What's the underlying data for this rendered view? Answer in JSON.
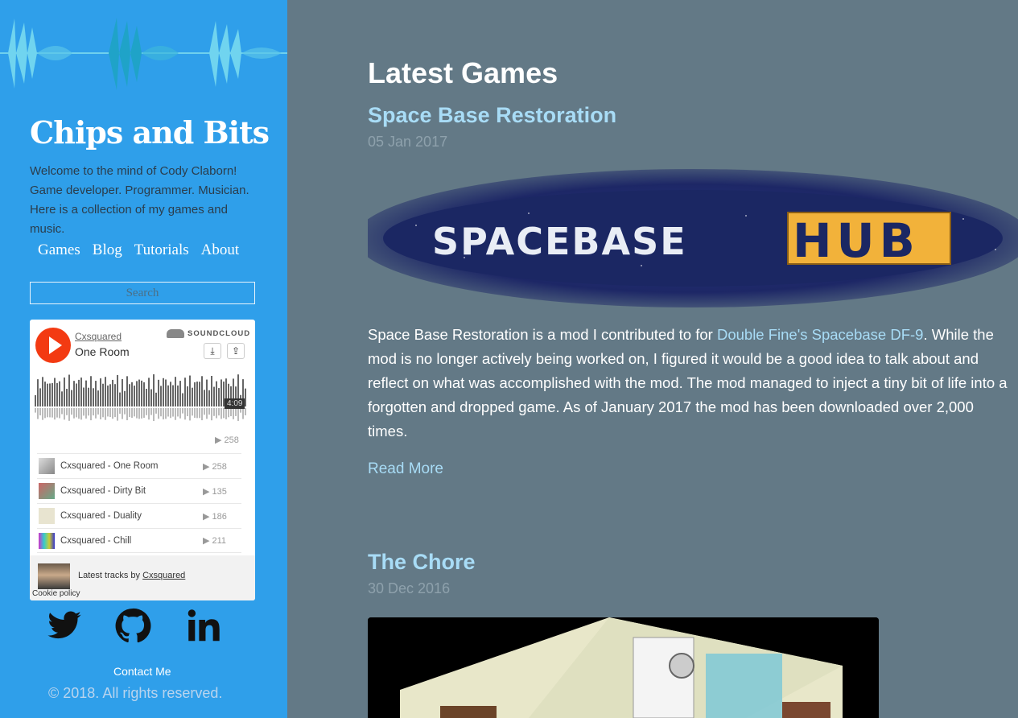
{
  "sidebar": {
    "title": "Chips and Bits",
    "description": "Welcome to the mind of Cody Claborn! Game developer. Programmer. Musician. Here is a collection of my games and music.",
    "nav": [
      "Games",
      "Blog",
      "Tutorials",
      "About"
    ],
    "search_placeholder": "Search",
    "contact": "Contact Me",
    "copyright": "© 2018. All rights reserved.",
    "social_icons": [
      "twitter-icon",
      "github-icon",
      "linkedin-icon"
    ]
  },
  "soundcloud": {
    "user": "Cxsquared",
    "track": "One Room",
    "brand": "SOUNDCLOUD",
    "duration": "4:09",
    "plays": "258",
    "tracks": [
      {
        "title": "Cxsquared - One Room",
        "plays": "258"
      },
      {
        "title": "Cxsquared - Dirty Bit",
        "plays": "135"
      },
      {
        "title": "Cxsquared - Duality",
        "plays": "186"
      },
      {
        "title": "Cxsquared - Chill",
        "plays": "211"
      }
    ],
    "latest_prefix": "Latest tracks by",
    "latest_user": "Cxsquared",
    "cookie": "Cookie policy"
  },
  "main": {
    "heading": "Latest Games",
    "posts": [
      {
        "title": "Space Base Restoration",
        "date": "05 Jan 2017",
        "banner_text_1": "SPACEBASE",
        "banner_text_2": "HUB",
        "excerpt_before": "Space Base Restoration is a mod I contributed to for ",
        "excerpt_link": "Double Fine's Spacebase DF-9",
        "excerpt_after": ". While the mod is no longer actively being worked on, I figured it would be a good idea to talk about and reflect on what was accomplished with the mod. The mod managed to inject a tiny bit of life into a forgotten and dropped game. As of January 2017 the mod has been downloaded over 2,000 times.",
        "read_more": "Read More"
      },
      {
        "title": "The Chore",
        "date": "30 Dec 2016"
      }
    ]
  },
  "colors": {
    "sidebar_bg": "#2f9fea",
    "main_bg": "#637986",
    "link": "#a8dcf6",
    "soundcloud_orange": "#f33a12"
  }
}
